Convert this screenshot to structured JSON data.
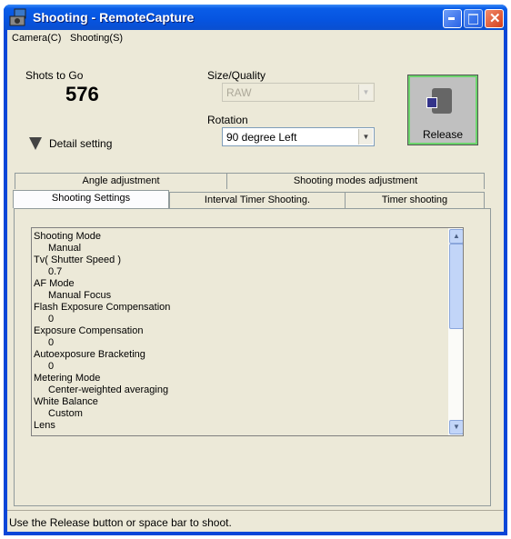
{
  "window": {
    "title": "Shooting - RemoteCapture"
  },
  "menu": [
    {
      "label": "Camera(C)"
    },
    {
      "label": "Shooting(S)"
    }
  ],
  "shots": {
    "label": "Shots to Go",
    "value": "576"
  },
  "size_quality": {
    "label": "Size/Quality",
    "value": "RAW"
  },
  "rotation": {
    "label": "Rotation",
    "value": "90 degree Left"
  },
  "release": {
    "label": "Release"
  },
  "detail": {
    "label": "Detail setting"
  },
  "tabs_back": [
    {
      "label": "Angle adjustment"
    },
    {
      "label": "Shooting modes adjustment"
    }
  ],
  "tabs_front": [
    {
      "label": "Shooting Settings"
    },
    {
      "label": "Interval Timer Shooting."
    },
    {
      "label": "Timer shooting"
    }
  ],
  "settings": [
    {
      "text": "Shooting Mode"
    },
    {
      "text": "Manual"
    },
    {
      "text": "Tv( Shutter Speed )"
    },
    {
      "text": "0.7"
    },
    {
      "text": "AF Mode"
    },
    {
      "text": "Manual Focus"
    },
    {
      "text": "Flash Exposure Compensation"
    },
    {
      "text": "0"
    },
    {
      "text": "Exposure Compensation"
    },
    {
      "text": "0"
    },
    {
      "text": "Autoexposure Bracketing"
    },
    {
      "text": "0"
    },
    {
      "text": "Metering Mode"
    },
    {
      "text": "Center-weighted averaging"
    },
    {
      "text": "White Balance"
    },
    {
      "text": "Custom"
    },
    {
      "text": "Lens"
    }
  ],
  "status": {
    "text": "Use the Release button or space bar to shoot."
  }
}
